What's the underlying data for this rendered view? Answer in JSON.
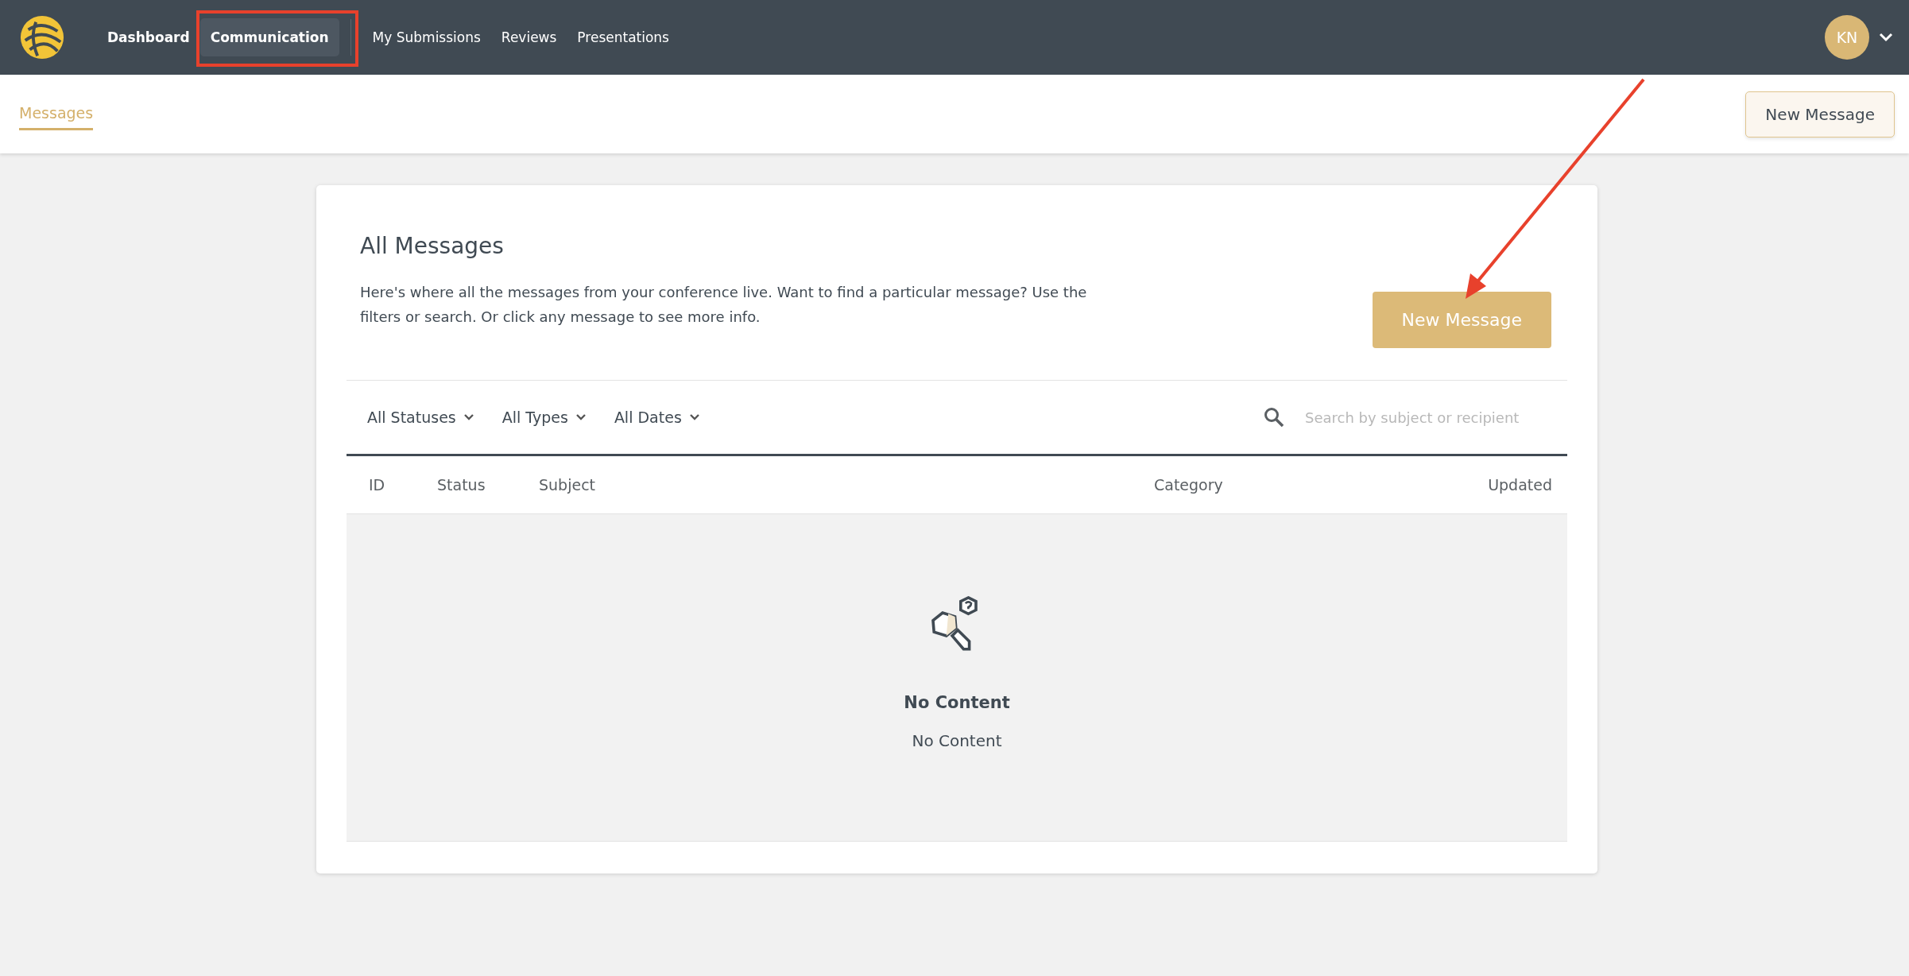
{
  "nav": {
    "items": [
      {
        "label": "Dashboard",
        "selected": false,
        "kind": "primary"
      },
      {
        "label": "Communication",
        "selected": true,
        "kind": "primary"
      },
      {
        "label": "My Submissions",
        "selected": false,
        "kind": "secondary"
      },
      {
        "label": "Reviews",
        "selected": false,
        "kind": "secondary"
      },
      {
        "label": "Presentations",
        "selected": false,
        "kind": "secondary"
      }
    ],
    "avatar": "KN"
  },
  "subnav": {
    "tabs": [
      {
        "label": "Messages",
        "selected": true
      }
    ],
    "button": "New Message"
  },
  "card": {
    "title": "All Messages",
    "description": "Here's where all the messages from your conference live. Want to find a particular message? Use the filters or search. Or click any message to see more info.",
    "button": "New Message",
    "filters": [
      "All Statuses",
      "All Types",
      "All Dates"
    ],
    "search": {
      "placeholder": "Search by subject or recipient"
    },
    "table": {
      "columns": [
        "ID",
        "Status",
        "Subject",
        "Category",
        "Updated"
      ],
      "empty": {
        "title": "No Content",
        "text": "No Content"
      }
    }
  }
}
